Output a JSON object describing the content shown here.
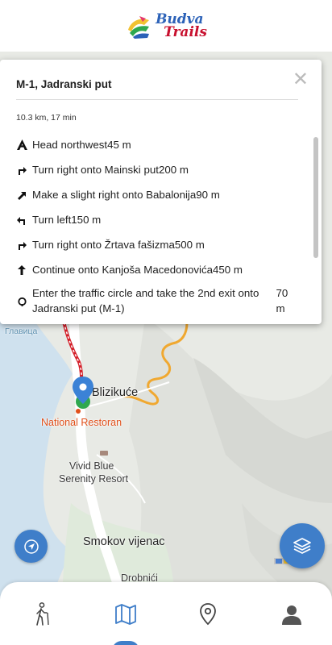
{
  "header": {
    "logo_line1": "Budva",
    "logo_line2": "Trails"
  },
  "popup": {
    "title": "M-1, Jadranski put",
    "close_symbol": "✕",
    "summary": "10.3 km, 17 min",
    "steps": [
      {
        "icon": "depart-icon",
        "text": "Head northwest",
        "distance": "45 m"
      },
      {
        "icon": "turn-right-icon",
        "text": "Turn right onto Mainski put",
        "distance": "200 m"
      },
      {
        "icon": "slight-right-icon",
        "text": "Make a slight right onto Babalonija",
        "distance": "90 m"
      },
      {
        "icon": "turn-left-icon",
        "text": "Turn left",
        "distance": "150 m"
      },
      {
        "icon": "turn-right-icon",
        "text": "Turn right onto Žrtava fašizma",
        "distance": "500 m"
      },
      {
        "icon": "continue-icon",
        "text": "Continue onto Kanjoša Macedonovića",
        "distance": "450 m"
      },
      {
        "icon": "roundabout-icon",
        "text": "Enter the traffic circle and take the 2nd exit onto Jadranski put (M-1)",
        "distance": "70 m"
      }
    ]
  },
  "map": {
    "labels": {
      "glavica": "Главица",
      "blizikuce": "Blizikuće",
      "restaurant": "National Restoran",
      "resort_line1": "Vivid Blue",
      "resort_line2": "Serenity Resort",
      "smokov": "Smokov vijenac",
      "bottom_partial": "Drobnići"
    }
  },
  "nav": {
    "items": [
      {
        "name": "trails",
        "icon": "hiker-icon"
      },
      {
        "name": "map",
        "icon": "map-icon",
        "active": true
      },
      {
        "name": "places",
        "icon": "location-pin-icon"
      },
      {
        "name": "profile",
        "icon": "user-icon"
      }
    ]
  },
  "colors": {
    "accent": "#3f7ec9",
    "route_red": "#d4202a",
    "trail_orange": "#f0a830",
    "marker_green": "#2fa84f",
    "poi_orange": "#e1501b",
    "sea": "#cfe1ee"
  }
}
